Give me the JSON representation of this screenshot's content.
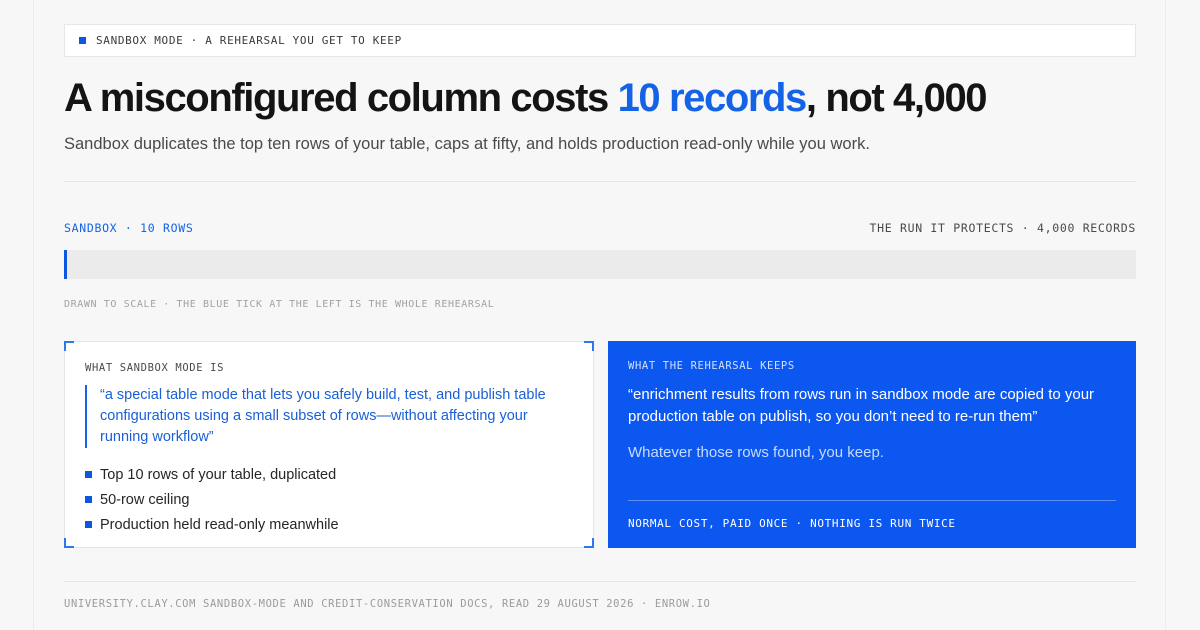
{
  "eyebrow": {
    "text": "SANDBOX MODE · A REHEARSAL YOU GET TO KEEP"
  },
  "headline": {
    "before": "A misconfigured column costs ",
    "accent": "10 records",
    "after": ", not 4,000"
  },
  "subhead": "Sandbox duplicates the top ten rows of your table, caps at fifty, and holds production read-only while you work.",
  "scale": {
    "left_label": "SANDBOX · 10 ROWS",
    "right_label": "THE RUN IT PROTECTS · 4,000 RECORDS",
    "sandbox_rows": 10,
    "total_records": 4000,
    "note": "DRAWN TO SCALE · THE BLUE TICK AT THE LEFT IS THE WHOLE REHEARSAL"
  },
  "left_card": {
    "label": "WHAT SANDBOX MODE IS",
    "quote": "“a special table mode that lets you safely build, test, and publish table configurations using a small subset of rows—without affecting your running workflow”",
    "bullets": [
      "Top 10 rows of your table, duplicated",
      "50-row ceiling",
      "Production held read-only meanwhile"
    ]
  },
  "right_card": {
    "label": "WHAT THE REHEARSAL KEEPS",
    "quote": "“enrichment results from rows run in sandbox mode are copied to your production table on publish, so you don’t need to re-run them”",
    "keep": "Whatever those rows found, you keep.",
    "footer": "NORMAL COST, PAID ONCE · NOTHING IS RUN TWICE"
  },
  "source": "UNIVERSITY.CLAY.COM SANDBOX-MODE AND CREDIT-CONSERVATION DOCS, READ 29 AUGUST 2026 · ENROW.IO",
  "colors": {
    "accent": "#1463e6",
    "panel_blue": "#0b57f0",
    "background": "#f7f7f7"
  }
}
